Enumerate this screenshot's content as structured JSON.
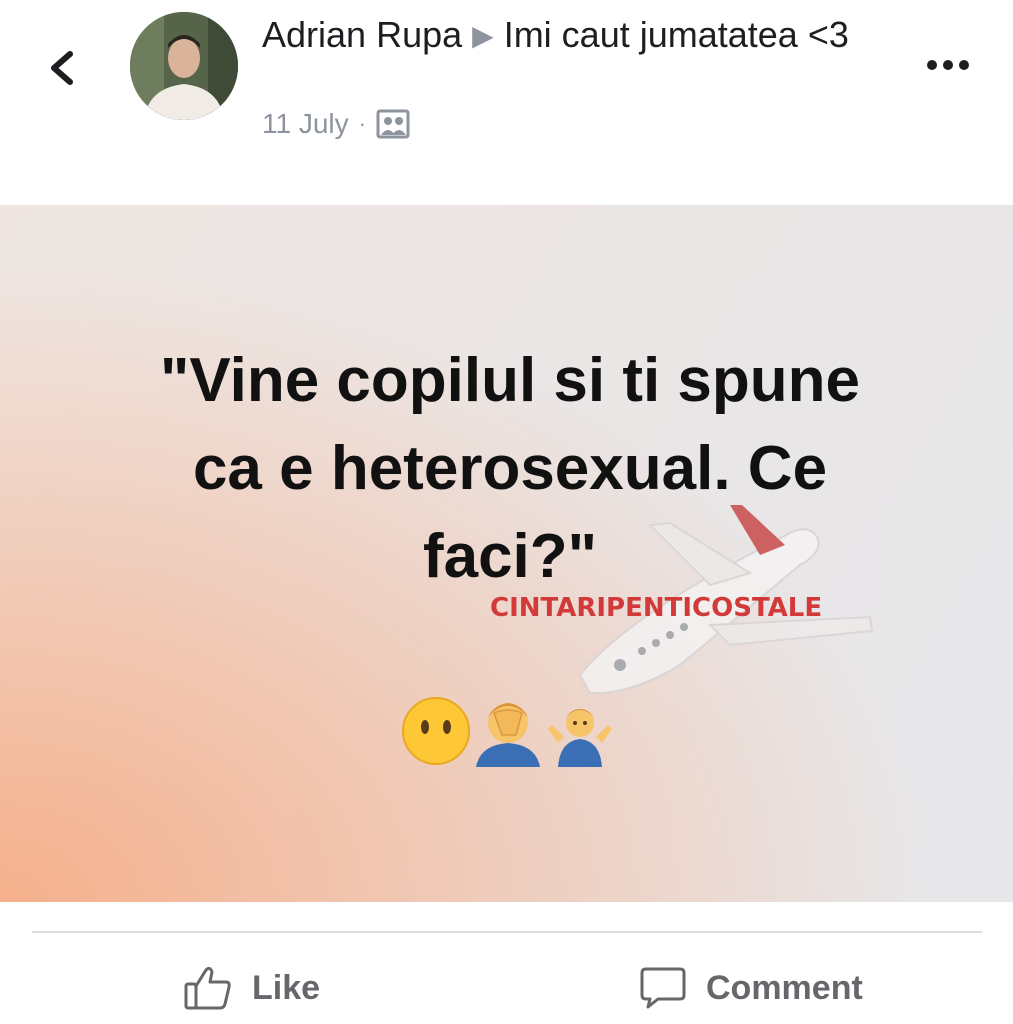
{
  "header": {
    "author": "Adrian Rupa",
    "separator": "▶",
    "group": "Imi caut jumatatea <3",
    "date": "11 July",
    "dot": "·",
    "back_icon": "chevron-left-icon",
    "more_icon": "ellipsis-icon",
    "audience_icon": "group-audience-icon"
  },
  "post": {
    "quote": "\"Vine copilul si ti spune\nca e heterosexual. Ce\nfaci?\"",
    "watermark": "CINTARIPENTICOSTALE",
    "emojis": [
      "no-mouth-face",
      "facepalm",
      "shrug"
    ],
    "bg_gradient_colors": [
      "#f5b08c",
      "#eae6e6"
    ]
  },
  "actions": {
    "like_label": "Like",
    "comment_label": "Comment"
  },
  "colors": {
    "text": "#1c1e21",
    "muted": "#8d949e",
    "action": "#65676b",
    "watermark": "#d23a3a"
  }
}
